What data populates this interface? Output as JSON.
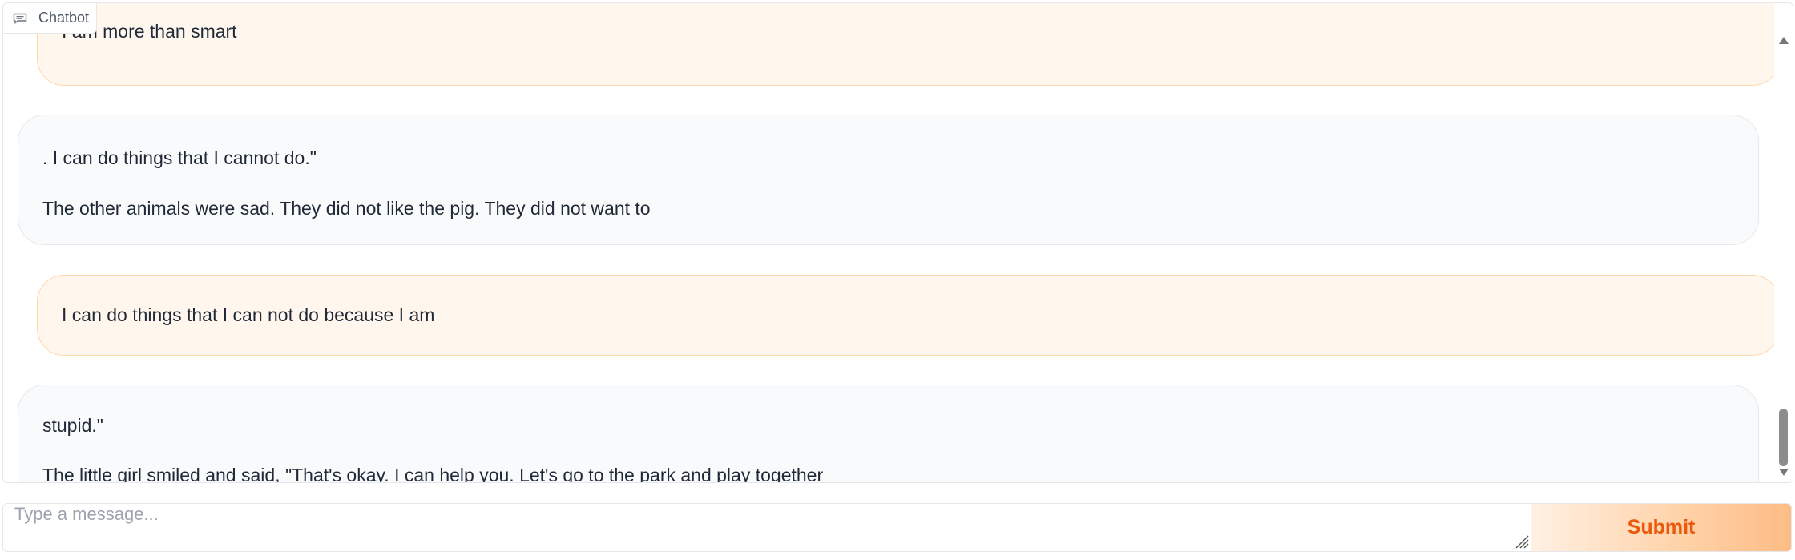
{
  "panel": {
    "label": "Chatbot",
    "label_icon": "chat-bubble-icon"
  },
  "messages": [
    {
      "role": "user",
      "lines": [
        "I am more than smart"
      ]
    },
    {
      "role": "bot",
      "lines": [
        ". I can do things that I cannot do.\"",
        "The other animals were sad. They did not like the pig. They did not want to"
      ]
    },
    {
      "role": "user",
      "lines": [
        "I can do things that I can not do because I am"
      ]
    },
    {
      "role": "bot",
      "lines": [
        "stupid.\"",
        "The little girl smiled and said, \"That's okay. I can help you. Let's go to the park and play together"
      ]
    }
  ],
  "input": {
    "value": "",
    "placeholder": "Type a message..."
  },
  "submit": {
    "label": "Submit"
  },
  "colors": {
    "accent": "#ea580c",
    "user_bubble": "#fff7ed",
    "bot_bubble": "#f9fafb"
  }
}
